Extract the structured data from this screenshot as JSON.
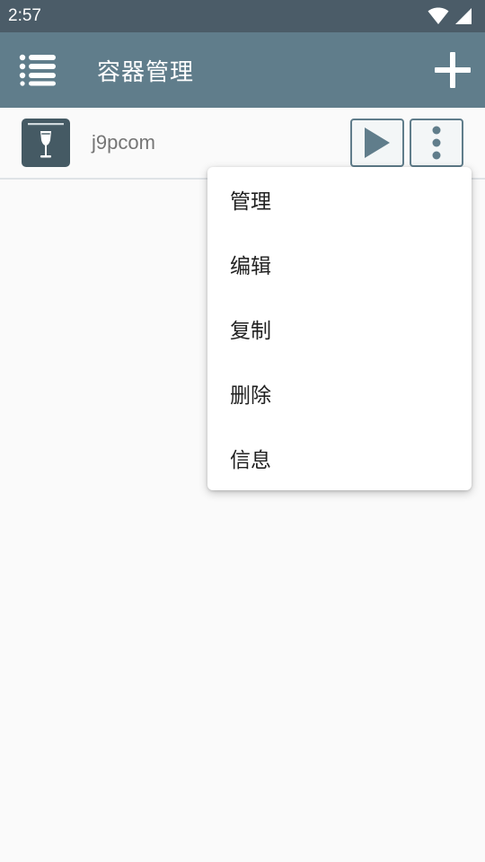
{
  "status_bar": {
    "time": "2:57",
    "icons": [
      "wifi-icon",
      "cellular-signal-icon"
    ]
  },
  "app_bar": {
    "menu_icon": "list-menu-icon",
    "title": "容器管理",
    "add_icon": "plus-icon"
  },
  "containers": [
    {
      "name": "j9pcom",
      "icon": "wine-glass-box-icon",
      "run_icon": "play-icon",
      "more_icon": "more-vertical-icon"
    }
  ],
  "popup_menu": {
    "items": [
      "管理",
      "编辑",
      "复制",
      "删除",
      "信息"
    ]
  },
  "colors": {
    "status_bar": "#4b5c68",
    "app_bar": "#607d8b",
    "icon_dark": "#455a64",
    "background": "#fafafa"
  }
}
